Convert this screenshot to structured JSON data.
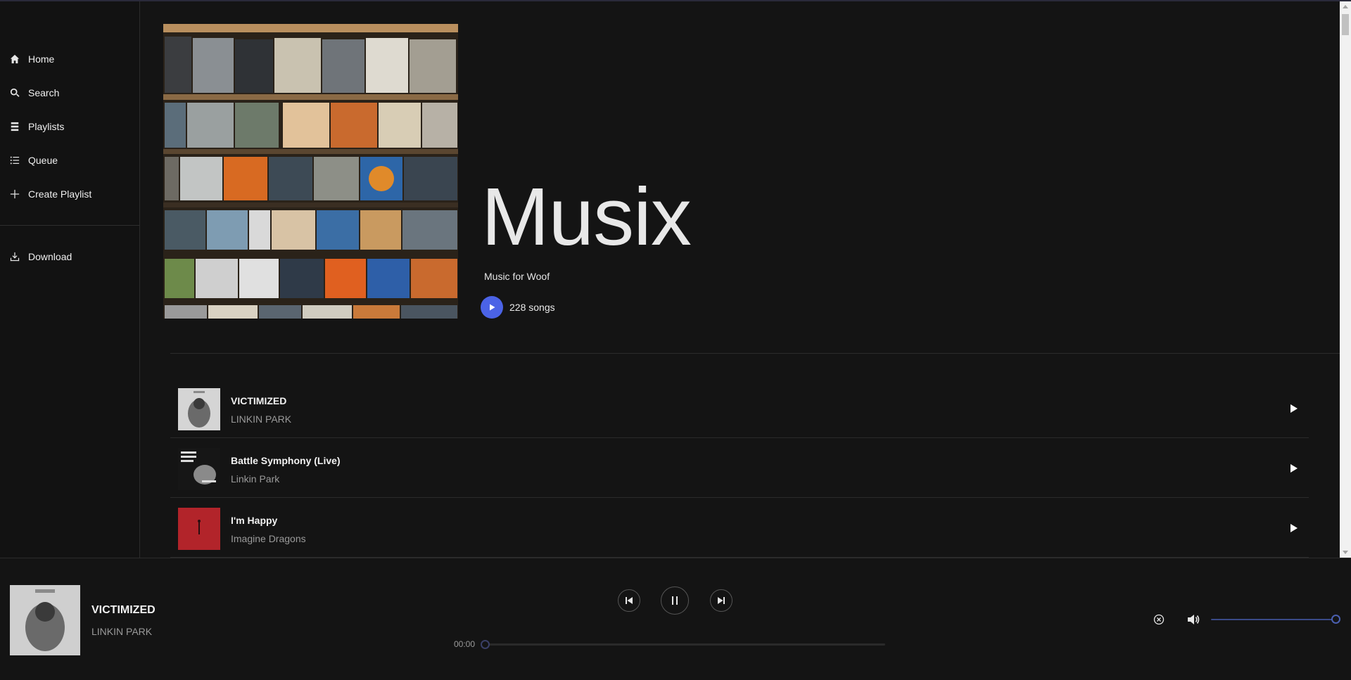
{
  "sidebar": {
    "items": [
      {
        "label": "Home",
        "icon": "home-icon"
      },
      {
        "label": "Search",
        "icon": "search-icon"
      },
      {
        "label": "Playlists",
        "icon": "playlists-icon"
      },
      {
        "label": "Queue",
        "icon": "queue-icon"
      },
      {
        "label": "Create Playlist",
        "icon": "plus-icon"
      }
    ],
    "secondary_items": [
      {
        "label": "Download",
        "icon": "download-icon"
      }
    ]
  },
  "playlist": {
    "title": "Musix",
    "subtitle": "Music for Woof",
    "songs_count": "228 songs"
  },
  "tracks": [
    {
      "name": "VICTIMIZED",
      "artist": "LINKIN PARK"
    },
    {
      "name": "Battle Symphony (Live)",
      "artist": "Linkin Park"
    },
    {
      "name": "I'm Happy",
      "artist": "Imagine Dragons"
    }
  ],
  "player": {
    "title": "VICTIMIZED",
    "artist": "LINKIN PARK",
    "elapsed": "00:00",
    "progress_fraction": 0.0,
    "volume_fraction": 1.0
  },
  "colors": {
    "background": "#141414",
    "accent": "#4b63e6",
    "text_primary": "#e6e6e6",
    "text_secondary": "#9a9a9a"
  }
}
